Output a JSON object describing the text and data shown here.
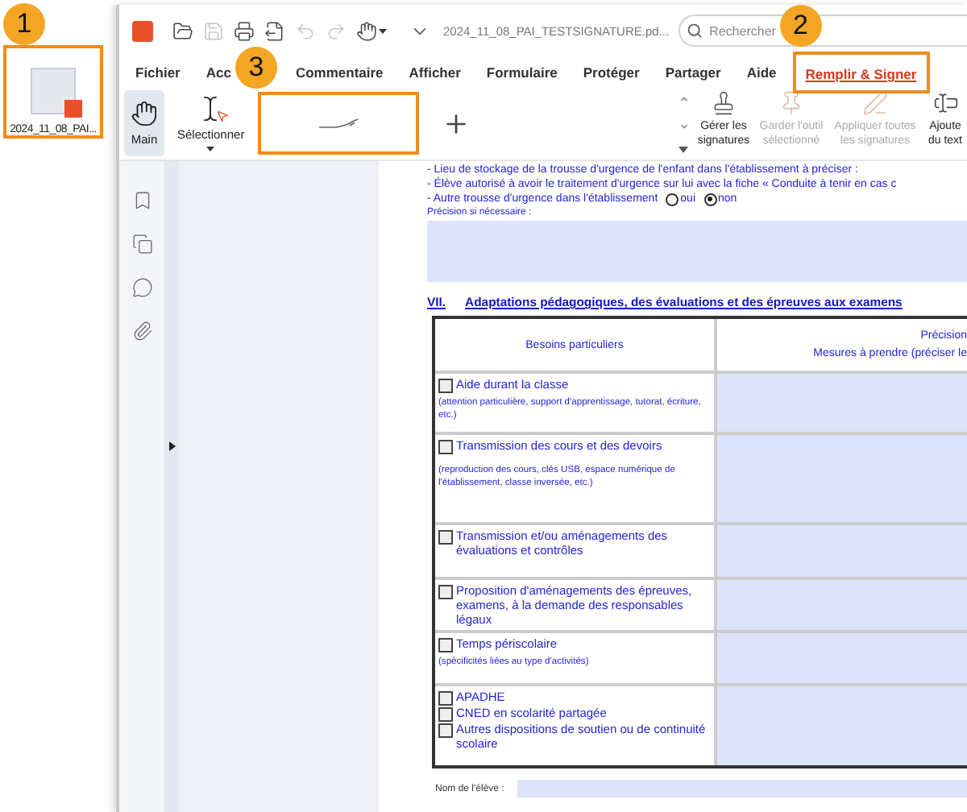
{
  "desktop": {
    "file_icon": {
      "label": "2024_11_08_PAI...",
      "highlighted": true,
      "callout": "1"
    }
  },
  "window": {
    "toolbar_icons": [
      {
        "kind": "open",
        "disabled": false
      },
      {
        "kind": "save",
        "disabled": true
      },
      {
        "kind": "print",
        "disabled": false
      },
      {
        "kind": "export",
        "disabled": false
      },
      {
        "kind": "undo",
        "disabled": true
      },
      {
        "kind": "redo",
        "disabled": true
      },
      {
        "kind": "hand",
        "disabled": false
      }
    ],
    "filename": "2024_11_08_PAI_TESTSIGNATURE.pd...",
    "search": {
      "placeholder": "Rechercher"
    }
  },
  "menu": [
    {
      "label": "Fichier",
      "selected": false
    },
    {
      "label": "Acc",
      "selected": false
    },
    {
      "label": "Commentaire",
      "selected": false
    },
    {
      "label": "Afficher",
      "selected": false
    },
    {
      "label": "Formulaire",
      "selected": false
    },
    {
      "label": "Protéger",
      "selected": false
    },
    {
      "label": "Partager",
      "selected": false
    },
    {
      "label": "Aide",
      "selected": false
    },
    {
      "label": "Remplir & Signer",
      "selected": true,
      "highlighted": true,
      "callout": "2"
    }
  ],
  "ribbon": {
    "tools": [
      {
        "kind": "hand",
        "label": "Main",
        "selected": true
      },
      {
        "kind": "select",
        "label": "Sélectionner",
        "selected": false
      }
    ],
    "signature_box": {
      "highlighted": true,
      "callout": "3"
    },
    "actions": [
      {
        "kind": "manage",
        "label": "Gérer les signatures",
        "disabled": false
      },
      {
        "kind": "pin",
        "label": "Garder l'outil sélectionné",
        "disabled": true
      },
      {
        "kind": "apply",
        "label": "Appliquer toutes les signatures",
        "disabled": true
      },
      {
        "kind": "text",
        "label": "Ajoute du text",
        "disabled": false
      }
    ]
  },
  "document": {
    "lines": [
      "- Lieu de stockage de la trousse d'urgence de l'enfant dans l'établissement à préciser :",
      "- Élève autorisé à avoir le traitement d'urgence sur lui avec la fiche « Conduite à tenir en cas c"
    ],
    "radio_question": {
      "label": "- Autre trousse d'urgence dans l'établissement",
      "options": [
        {
          "label": "oui",
          "selected": false
        },
        {
          "label": "non",
          "selected": true
        }
      ]
    },
    "precision_label": "Précision si nécessaire :",
    "section": {
      "number": "VII.",
      "title": "Adaptations pédagogiques, des évaluations et des épreuves aux examens"
    },
    "table": {
      "columns": [
        {
          "lines": [
            "Besoins particuliers"
          ]
        },
        {
          "lines": [
            "Précision",
            "Mesures à prendre (préciser le"
          ]
        }
      ],
      "rows": [
        {
          "options": [
            {
              "label": "Aide durant la classe",
              "checked": false
            }
          ],
          "note": "(attention particulière, support d'apprentissage, tutorat, écriture, etc.)"
        },
        {
          "options": [
            {
              "label": "Transmission des cours et des devoirs",
              "checked": false
            }
          ],
          "note": "(reproduction des cours, clés USB, espace numérique de l'établissement, classe inversée, etc.)"
        },
        {
          "options": [
            {
              "label": "Transmission et/ou aménagements des évaluations et contrôles",
              "checked": false
            }
          ]
        },
        {
          "options": [
            {
              "label": "Proposition d'aménagements des épreuves, examens, à la demande des responsables légaux",
              "checked": false
            }
          ]
        },
        {
          "options": [
            {
              "label": "Temps périscolaire",
              "checked": false
            }
          ],
          "note": "(spécificités liées au type d'activités)"
        },
        {
          "options": [
            {
              "label": "APADHE",
              "checked": false
            },
            {
              "label": "CNED en scolarité partagée",
              "checked": false
            },
            {
              "label": "Autres dispositions de soutien ou de continuité scolaire",
              "checked": false
            }
          ]
        }
      ]
    },
    "student_name_label": "Nom de l'élève :"
  }
}
